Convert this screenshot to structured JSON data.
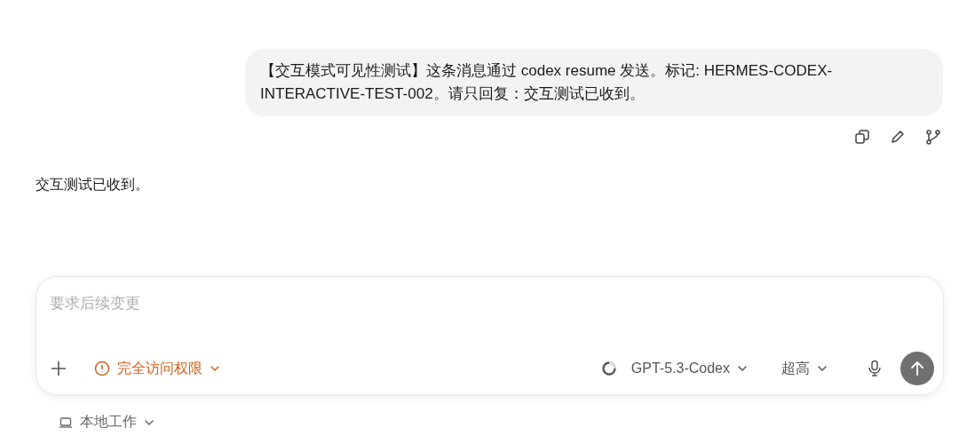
{
  "user_message": {
    "text": "【交互模式可见性测试】这条消息通过 codex resume 发送。标记: HERMES-CODEX-INTERACTIVE-TEST-002。请只回复：交互测试已收到。"
  },
  "assistant_message": {
    "text": "交互测试已收到。"
  },
  "composer": {
    "placeholder": "要求后续变更",
    "access_mode": {
      "label": "完全访问权限"
    },
    "model": {
      "label": "GPT-5.3-Codex"
    },
    "reasoning": {
      "label": "超高"
    }
  },
  "footer": {
    "workspace": {
      "label": "本地工作"
    }
  }
}
